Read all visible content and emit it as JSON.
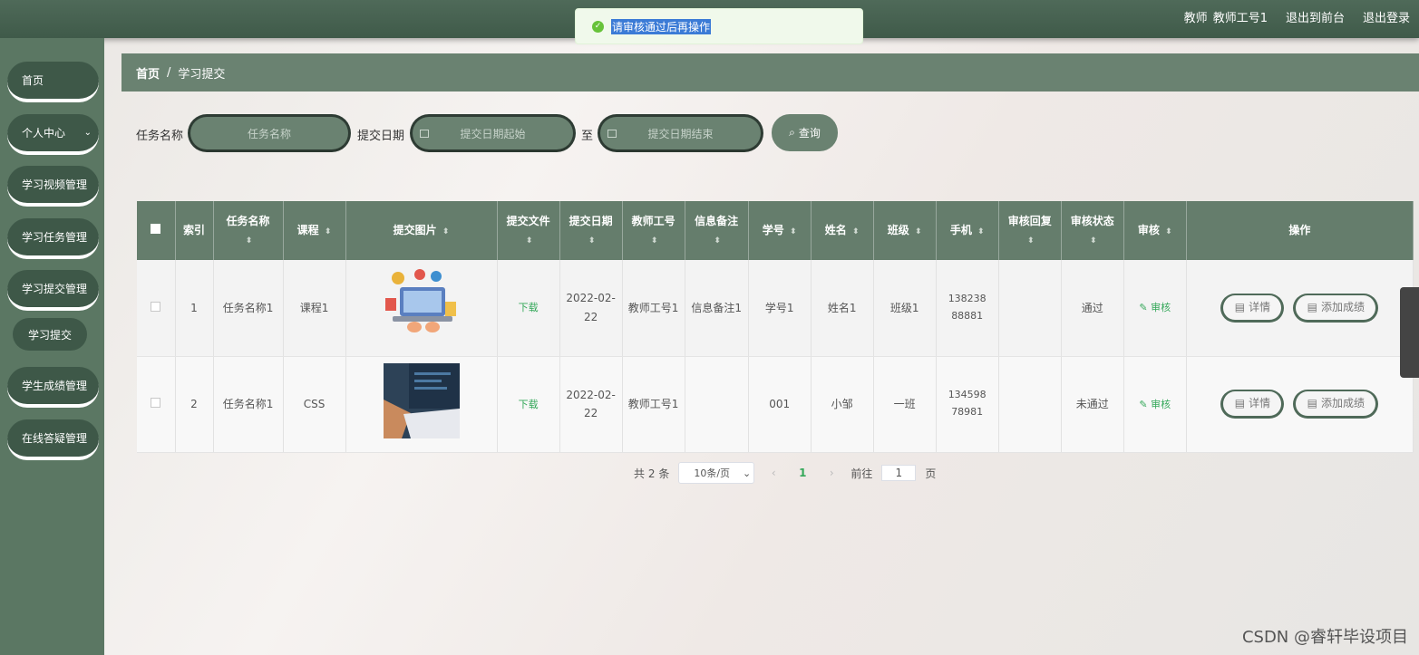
{
  "topbar": {
    "role": "教师",
    "user": "教师工号1",
    "front": "退出到前台",
    "logout": "退出登录"
  },
  "toast": {
    "message": "请审核通过后再操作",
    "status_color": "#67c23a"
  },
  "sidebar": {
    "items": [
      {
        "label": "首页"
      },
      {
        "label": "个人中心"
      },
      {
        "label": "学习视频管理"
      },
      {
        "label": "学习任务管理"
      },
      {
        "label": "学习提交管理"
      },
      {
        "label": "学生成绩管理"
      },
      {
        "label": "在线答疑管理"
      }
    ],
    "active_sub": "学习提交"
  },
  "breadcrumb": {
    "home": "首页",
    "separator": "/",
    "current": "学习提交"
  },
  "search": {
    "task_label": "任务名称",
    "task_placeholder": "任务名称",
    "date_label": "提交日期",
    "date_start_placeholder": "提交日期起始",
    "to": "至",
    "date_end_placeholder": "提交日期结束",
    "query_button": "查询"
  },
  "table": {
    "headers": {
      "index": "索引",
      "task": "任务名称",
      "course": "课程",
      "image": "提交图片",
      "file": "提交文件",
      "date": "提交日期",
      "teacher": "教师工号",
      "note": "信息备注",
      "student_no": "学号",
      "name": "姓名",
      "class": "班级",
      "phone": "手机",
      "reply": "审核回复",
      "status": "审核状态",
      "review": "审核",
      "ops": "操作"
    },
    "rows": [
      {
        "index": "1",
        "task": "任务名称1",
        "course": "课程1",
        "file": "下载",
        "date": "2022-02-22",
        "teacher": "教师工号1",
        "note": "信息备注1",
        "student_no": "学号1",
        "name": "姓名1",
        "class": "班级1",
        "phone": "13823888881",
        "reply": "",
        "status": "通过",
        "review": "审核",
        "detail": "详情",
        "add_score": "添加成绩"
      },
      {
        "index": "2",
        "task": "任务名称1",
        "course": "CSS",
        "file": "下载",
        "date": "2022-02-22",
        "teacher": "教师工号1",
        "note": "",
        "student_no": "001",
        "name": "小邹",
        "class": "一班",
        "phone": "13459878981",
        "reply": "",
        "status": "未通过",
        "review": "审核",
        "detail": "详情",
        "add_score": "添加成绩"
      }
    ]
  },
  "pagination": {
    "total_prefix": "共",
    "total": "2",
    "total_suffix": "条",
    "page_size": "10条/页",
    "current_page": "1",
    "goto_label": "前往",
    "goto_value": "1",
    "goto_suffix": "页"
  },
  "watermark": "CSDN @睿轩毕设项目",
  "colors": {
    "accent": "#5b7763",
    "dark": "#3e5848",
    "green_link": "#35a85a"
  }
}
